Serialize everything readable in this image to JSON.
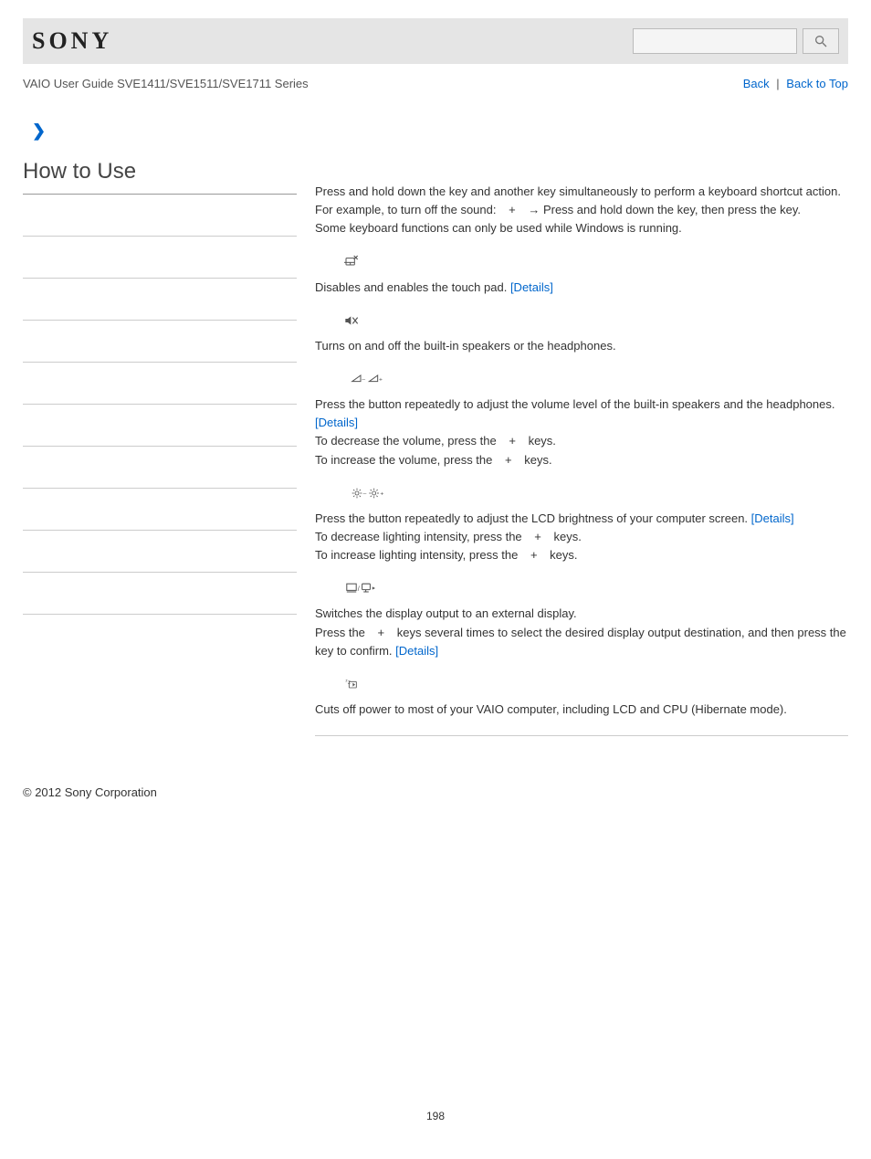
{
  "header": {
    "logo_text": "SONY",
    "search_placeholder": ""
  },
  "subheader": {
    "guide_title": "VAIO User Guide SVE1411/SVE1511/SVE1711 Series",
    "back_label": "Back",
    "separator": "|",
    "back_to_top_label": "Back to Top"
  },
  "sidebar": {
    "title": "How to Use",
    "row_count": 10
  },
  "intro": {
    "line1a": "Press and hold down the ",
    "line1b": " key and another key simultaneously to perform a keyboard shortcut action.",
    "line2a": "For example, to turn off the sound: ",
    "line2b": " → Press and hold down the ",
    "line2c": " key, then press the ",
    "line2d": " key.",
    "line3": "Some keyboard functions can only be used while Windows is running."
  },
  "functions": {
    "touchpad": {
      "desc_a": "Disables and enables the touch pad. ",
      "details": "[Details]"
    },
    "mute": {
      "desc": "Turns on and off the built-in speakers or the headphones."
    },
    "volume": {
      "p1a": "Press the button repeatedly to adjust the volume level of the built-in speakers and the headphones. ",
      "p1_details": "[Details]",
      "p2a": "To decrease the volume, press the ",
      "p2b": " keys.",
      "p3a": "To increase the volume, press the ",
      "p3b": " keys."
    },
    "brightness": {
      "p1a": "Press the button repeatedly to adjust the LCD brightness of your computer screen. ",
      "p1_details": "[Details]",
      "p2a": "To decrease lighting intensity, press the ",
      "p2b": " keys.",
      "p3a": "To increase lighting intensity, press the ",
      "p3b": " keys."
    },
    "display": {
      "p1": "Switches the display output to an external display.",
      "p2a": "Press the ",
      "p2b": " keys several times to select the desired display output destination, and then press the ",
      "p2c": " key to confirm. ",
      "p2_details": "[Details]"
    },
    "hibernate": {
      "desc": "Cuts off power to most of your VAIO computer, including LCD and CPU (Hibernate mode)."
    }
  },
  "shared": {
    "plus": "+"
  },
  "footer": {
    "copyright": "© 2012 Sony Corporation",
    "page_number": "198"
  }
}
